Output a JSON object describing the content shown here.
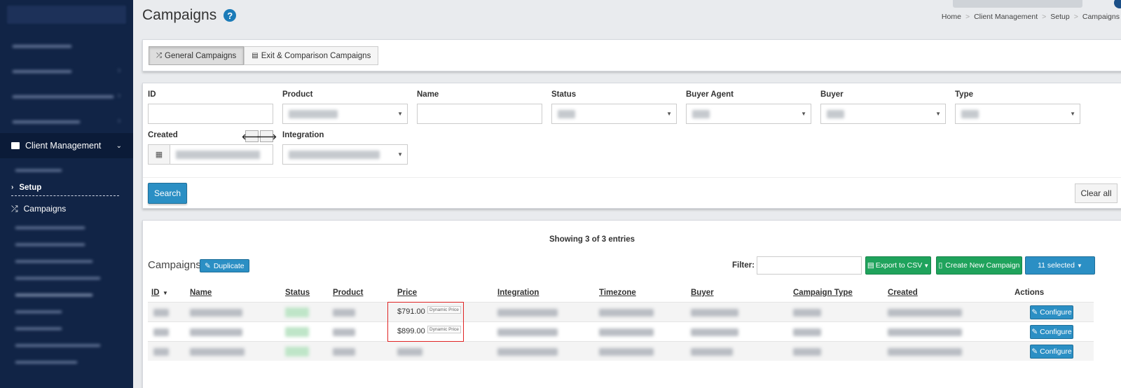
{
  "sidebar": {
    "client_management_label": "Client Management",
    "setup_label": "Setup",
    "campaigns_label": "Campaigns"
  },
  "header": {
    "title": "Campaigns",
    "breadcrumb": [
      "Home",
      "Client Management",
      "Setup",
      "Campaigns"
    ]
  },
  "tabs": [
    {
      "label": "General Campaigns",
      "icon": "shuffle-icon",
      "active": true
    },
    {
      "label": "Exit & Comparison Campaigns",
      "icon": "file-icon",
      "active": false
    }
  ],
  "filters": {
    "id_label": "ID",
    "product_label": "Product",
    "name_label": "Name",
    "status_label": "Status",
    "buyer_agent_label": "Buyer Agent",
    "buyer_label": "Buyer",
    "type_label": "Type",
    "created_label": "Created",
    "integration_label": "Integration",
    "search_button": "Search",
    "clear_button": "Clear all"
  },
  "table": {
    "showing_text": "Showing 3 of 3 entries",
    "title": "Campaigns",
    "duplicate_button": "Duplicate",
    "filter_label": "Filter:",
    "export_button": "Export to CSV",
    "create_button": "Create New Campaign",
    "selected_button": "11 selected",
    "columns": [
      "ID",
      "Name",
      "Status",
      "Product",
      "Price",
      "Integration",
      "Timezone",
      "Buyer",
      "Campaign Type",
      "Created",
      "Actions"
    ],
    "rows": [
      {
        "price": "$791.00",
        "price_badge": "Dynamic Price",
        "action": "Configure"
      },
      {
        "price": "$899.00",
        "price_badge": "Dynamic Price",
        "action": "Configure"
      },
      {
        "price": "",
        "price_badge": "",
        "action": "Configure"
      }
    ]
  },
  "colors": {
    "sidebar_bg": "#112446",
    "primary_blue": "#2b8fc4",
    "success_green": "#1fa35c",
    "highlight_red": "#e02424"
  }
}
